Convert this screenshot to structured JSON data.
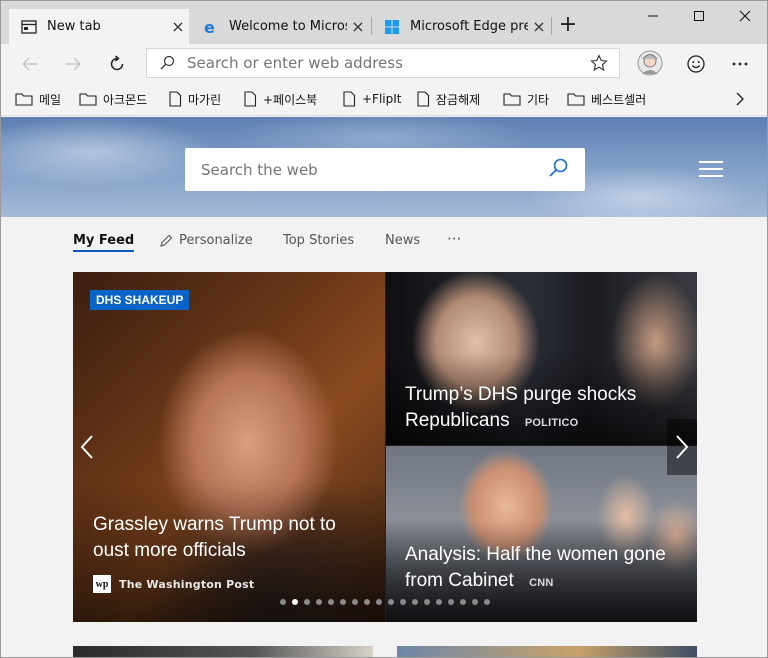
{
  "tabs": [
    {
      "label": "New tab",
      "icon": "new-tab-icon",
      "active": true
    },
    {
      "label": "Welcome to Microsoft Edge",
      "icon": "edge-e-icon",
      "active": false
    },
    {
      "label": "Microsoft Edge preview",
      "icon": "windows-logo-icon",
      "active": false
    }
  ],
  "new_tab_symbol": "+",
  "close_symbol": "×",
  "address": {
    "placeholder": "Search or enter web address"
  },
  "favorites": [
    {
      "label": "메일",
      "icon": "folder-icon"
    },
    {
      "label": "아크몬드",
      "icon": "folder-icon"
    },
    {
      "label": "마가린",
      "icon": "page-icon"
    },
    {
      "label": "+페이스북",
      "icon": "page-icon"
    },
    {
      "label": "+FlipIt",
      "icon": "page-icon"
    },
    {
      "label": "잠금해제",
      "icon": "page-icon"
    },
    {
      "label": "기타",
      "icon": "folder-icon"
    },
    {
      "label": "베스트셀러",
      "icon": "folder-icon"
    }
  ],
  "web_search": {
    "placeholder": "Search the web"
  },
  "feed_tabs": {
    "my_feed": "My Feed",
    "personalize": "Personalize",
    "top_stories": "Top Stories",
    "news": "News",
    "more": "···"
  },
  "carousel": {
    "badge": "DHS SHAKEUP",
    "main": {
      "headline": "Grassley warns Trump not to oust more officials",
      "source": "The Washington Post",
      "source_logo": "wp"
    },
    "side1": {
      "headline": "Trump’s DHS purge shocks Republicans",
      "source": "POLITICO"
    },
    "side2": {
      "headline": "Analysis: Half the women gone from Cabinet",
      "source": "CNN"
    },
    "dots_total": 18,
    "dots_active_index": 1
  },
  "colors": {
    "accent": "#0a64c8",
    "tab_active": "#f3f3f3",
    "tabstrip": "#d9d9d9"
  }
}
